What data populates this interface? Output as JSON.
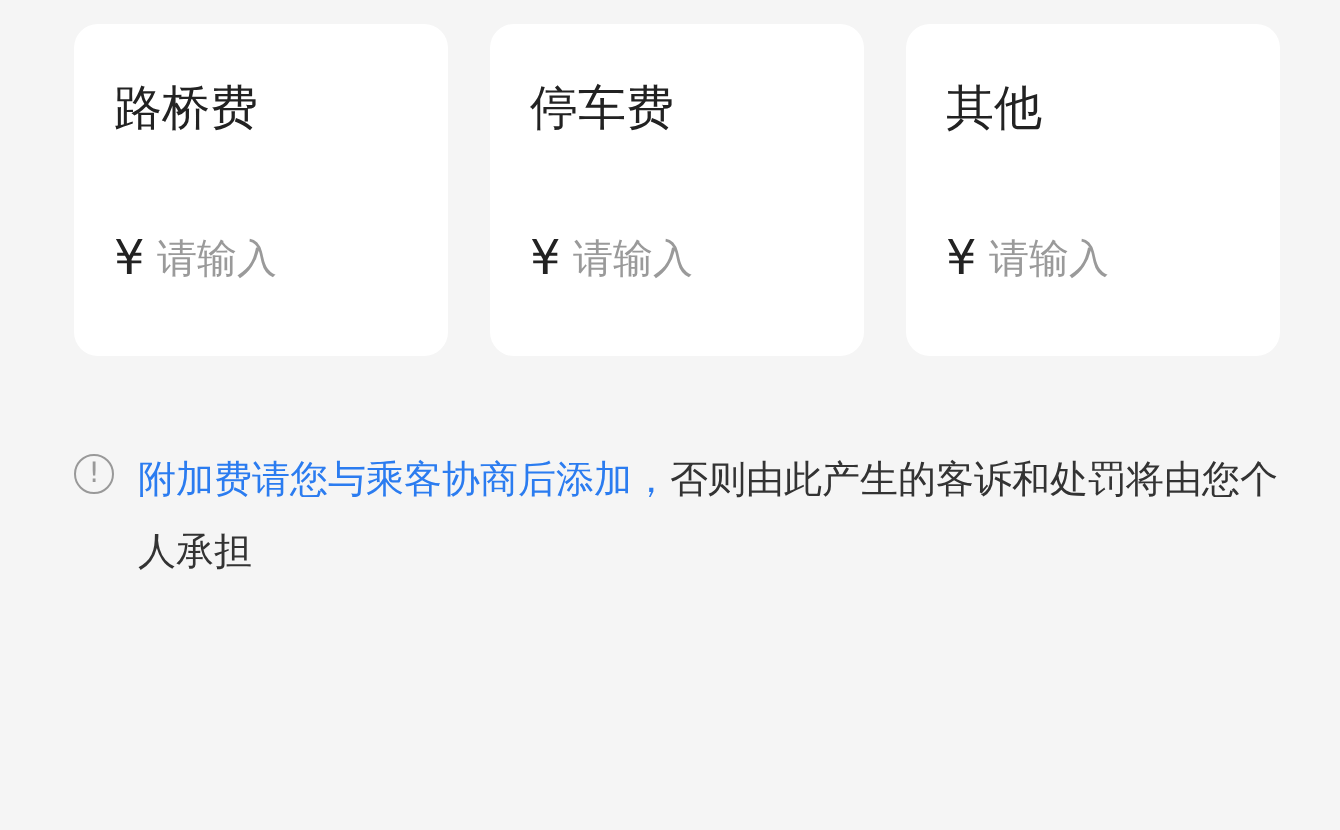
{
  "fees": [
    {
      "label": "路桥费",
      "currency": "¥",
      "placeholder": "请输入"
    },
    {
      "label": "停车费",
      "currency": "¥",
      "placeholder": "请输入"
    },
    {
      "label": "其他",
      "currency": "¥",
      "placeholder": "请输入"
    }
  ],
  "notice": {
    "icon": "!",
    "highlight": "附加费请您与乘客协商后添加，",
    "text": "否则由此产生的客诉和处罚将由您个人承担"
  }
}
